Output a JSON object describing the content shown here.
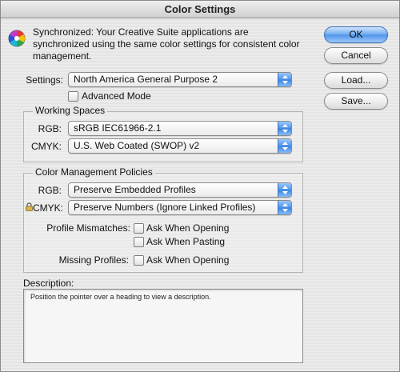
{
  "window": {
    "title": "Color Settings"
  },
  "sync": {
    "icon": "color-wheel-icon",
    "message": "Synchronized: Your Creative Suite applications are synchronized using the same color settings for consistent color management."
  },
  "buttons": {
    "ok": "OK",
    "cancel": "Cancel",
    "load": "Load...",
    "save": "Save..."
  },
  "settings": {
    "label": "Settings:",
    "value": "North America General Purpose 2",
    "advanced_mode_label": "Advanced Mode",
    "advanced_mode_checked": false
  },
  "working_spaces": {
    "title": "Working Spaces",
    "rgb_label": "RGB:",
    "rgb_value": "sRGB IEC61966-2.1",
    "cmyk_label": "CMYK:",
    "cmyk_value": "U.S. Web Coated (SWOP) v2"
  },
  "policies": {
    "title": "Color Management Policies",
    "rgb_label": "RGB:",
    "rgb_value": "Preserve Embedded Profiles",
    "cmyk_label": "CMYK:",
    "cmyk_value": "Preserve Numbers (Ignore Linked Profiles)",
    "cmyk_icon": "lock-icon",
    "profile_mismatches_label": "Profile Mismatches:",
    "ask_when_opening_label": "Ask When Opening",
    "ask_when_pasting_label": "Ask When Pasting",
    "missing_profiles_label": "Missing Profiles:",
    "missing_ask_when_opening_label": "Ask When Opening"
  },
  "description": {
    "label": "Description:",
    "text": "Position the pointer over a heading to view a description."
  },
  "colors": {
    "accent": "#4f93e8",
    "window_bg": "#ececec"
  }
}
